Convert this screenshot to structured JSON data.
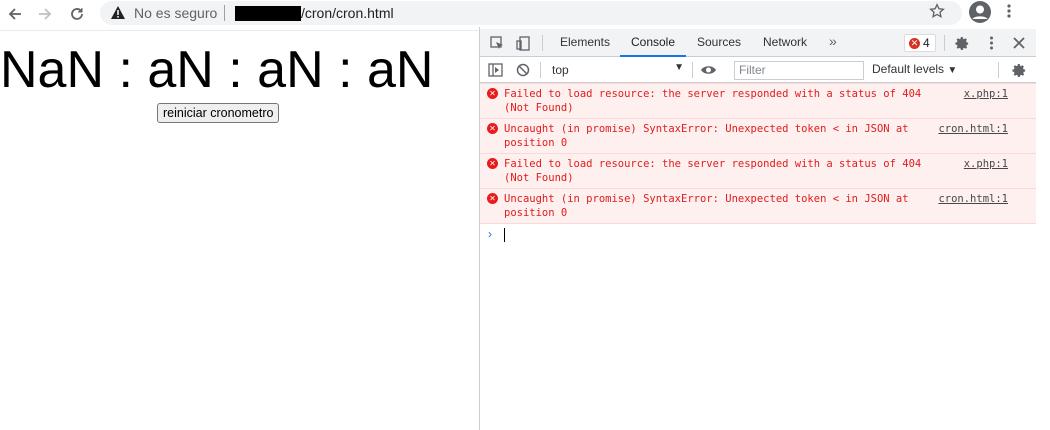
{
  "browser": {
    "security_label": "No es seguro",
    "url_path": "/cron/cron.html",
    "icons": [
      "back-arrow-icon",
      "forward-arrow-icon",
      "reload-icon",
      "warning-icon",
      "star-icon",
      "profile-icon",
      "kebab-menu-icon"
    ]
  },
  "page": {
    "timer_text": "NaN : aN : aN : aN",
    "restart_button": "reiniciar cronometro"
  },
  "devtools": {
    "tabs": [
      {
        "label": "Elements",
        "active": false
      },
      {
        "label": "Console",
        "active": true
      },
      {
        "label": "Sources",
        "active": false
      },
      {
        "label": "Network",
        "active": false
      }
    ],
    "more_tabs": "»",
    "error_count": "4",
    "context": "top",
    "filter_placeholder": "Filter",
    "levels_label": "Default levels",
    "levels_caret": "▼",
    "context_caret": "▼",
    "messages": [
      {
        "text": "Failed to load resource: the server responded with a status of 404\n(Not Found)",
        "source": "x.php:1"
      },
      {
        "text": "Uncaught (in promise) SyntaxError: Unexpected token < in JSON at\nposition 0",
        "source": "cron.html:1"
      },
      {
        "text": "Failed to load resource: the server responded with a status of 404\n(Not Found)",
        "source": "x.php:1"
      },
      {
        "text": "Uncaught (in promise) SyntaxError: Unexpected token < in JSON at\nposition 0",
        "source": "cron.html:1"
      }
    ],
    "prompt_symbol": "›",
    "colors": {
      "error_text": "#e01c1c",
      "error_bg": "#fff0f0",
      "accent": "#1a73e8"
    }
  }
}
